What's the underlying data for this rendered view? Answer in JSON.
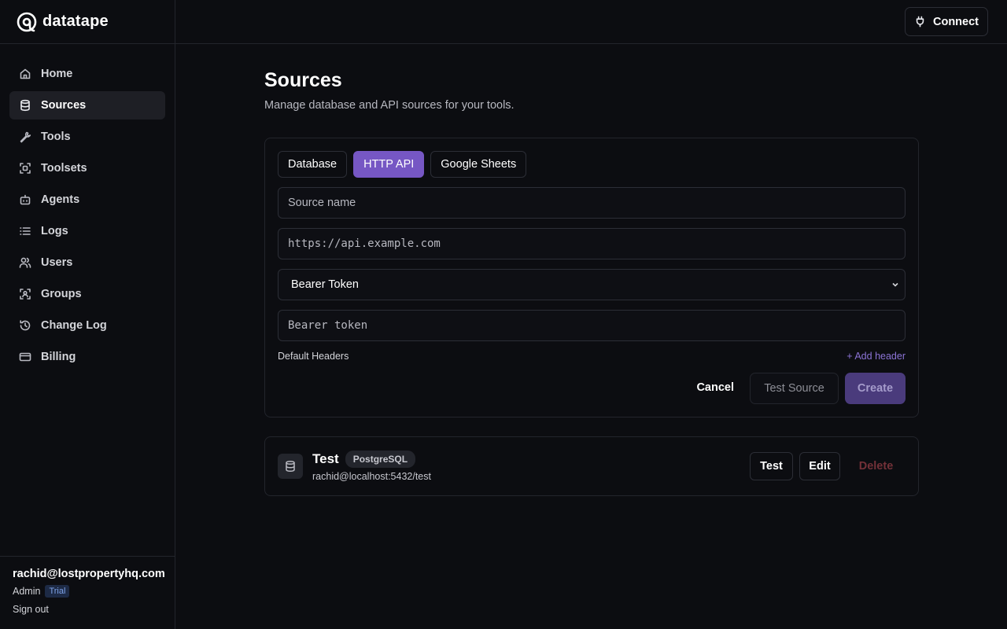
{
  "brand": {
    "name": "datatape"
  },
  "sidebar": {
    "items": [
      {
        "label": "Home",
        "icon": "home-icon"
      },
      {
        "label": "Sources",
        "icon": "database-icon",
        "active": true
      },
      {
        "label": "Tools",
        "icon": "wrench-icon"
      },
      {
        "label": "Toolsets",
        "icon": "toolset-icon"
      },
      {
        "label": "Agents",
        "icon": "bot-icon"
      },
      {
        "label": "Logs",
        "icon": "list-icon"
      },
      {
        "label": "Users",
        "icon": "users-icon"
      },
      {
        "label": "Groups",
        "icon": "group-icon"
      },
      {
        "label": "Change Log",
        "icon": "history-icon"
      },
      {
        "label": "Billing",
        "icon": "credit-card-icon"
      }
    ]
  },
  "user": {
    "email": "rachid@lostpropertyhq.com",
    "role": "Admin",
    "plan_badge": "Trial",
    "signout_label": "Sign out"
  },
  "topbar": {
    "connect_label": "Connect"
  },
  "page": {
    "title": "Sources",
    "subtitle": "Manage database and API sources for your tools."
  },
  "form": {
    "tabs": [
      {
        "label": "Database"
      },
      {
        "label": "HTTP API",
        "active": true
      },
      {
        "label": "Google Sheets"
      }
    ],
    "source_name_placeholder": "Source name",
    "url_placeholder": "https://api.example.com",
    "auth_type_value": "Bearer Token",
    "token_placeholder": "Bearer token",
    "headers_label": "Default Headers",
    "add_header_label": "+ Add header",
    "cancel_label": "Cancel",
    "test_label": "Test Source",
    "create_label": "Create"
  },
  "sources": [
    {
      "name": "Test",
      "type": "PostgreSQL",
      "connection": "rachid@localhost:5432/test",
      "test_label": "Test",
      "edit_label": "Edit",
      "delete_label": "Delete"
    }
  ],
  "colors": {
    "accent": "#7657c4",
    "background": "#0c0d11",
    "danger": "#733138"
  }
}
